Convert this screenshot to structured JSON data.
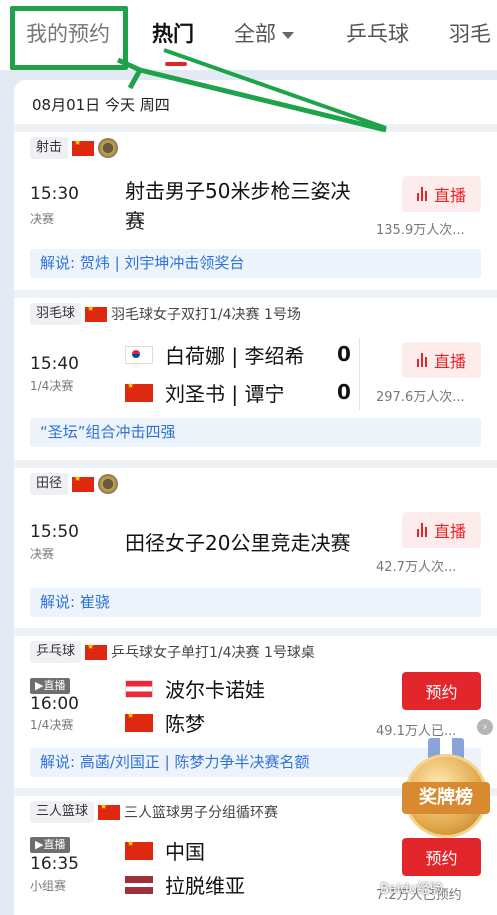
{
  "tabs": {
    "mine": "我的预约",
    "hot": "热门",
    "all": "全部",
    "pingpong": "乒乓球",
    "badminton": "羽毛"
  },
  "date_header": "08月01日 今天 周四",
  "labels": {
    "live": "直播",
    "book": "预约",
    "live_tag": "▶直播"
  },
  "events": [
    {
      "sport": "射击",
      "time": "15:30",
      "stage": "决赛",
      "title_line1": "射击男子50米步枪三姿决",
      "title_line2": "赛",
      "views": "135.9万人次...",
      "commentary": "解说: 贺炜 | 刘宇坤冲击领奖台"
    },
    {
      "sport": "羽毛球",
      "desc": "羽毛球女子双打1/4决赛 1号场",
      "time": "15:40",
      "stage": "1/4决赛",
      "team1": "白荷娜 | 李绍希",
      "score1": "0",
      "team2": "刘圣书 | 谭宁",
      "score2": "0",
      "views": "297.6万人次...",
      "commentary": "“圣坛”组合冲击四强"
    },
    {
      "sport": "田径",
      "time": "15:50",
      "stage": "决赛",
      "title": "田径女子20公里竞走决赛",
      "views": "42.7万人次...",
      "commentary": "解说: 崔骁"
    },
    {
      "sport": "乒乓球",
      "desc": "乒乓球女子单打1/4决赛 1号球桌",
      "time": "16:00",
      "stage": "1/4决赛",
      "team1": "波尔卡诺娃",
      "team2": "陈梦",
      "views": "49.1万人已...",
      "commentary": "解说: 高菡/刘国正 | 陈梦力争半决赛名额"
    },
    {
      "sport": "三人篮球",
      "desc": "三人篮球男子分组循环赛",
      "time": "16:35",
      "stage": "小组赛",
      "team1": "中国",
      "team2": "拉脱维亚",
      "views": "7.2万人已预约"
    }
  ],
  "rank_float": {
    "label": "奖牌榜"
  },
  "watermark": "Baidu经验",
  "colors": {
    "accent_red": "#e3262b",
    "commentary_blue": "#2f73d8",
    "annotation_green": "#1fa34a"
  }
}
